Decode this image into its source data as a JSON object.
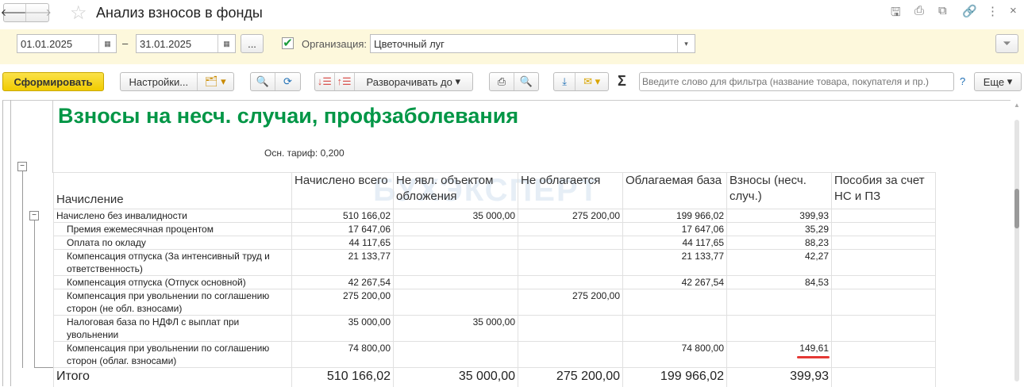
{
  "window": {
    "title": "Анализ взносов в фонды"
  },
  "filters": {
    "date_from": "01.01.2025",
    "date_to": "31.01.2025",
    "dash": "–",
    "more": "...",
    "org_label": "Организация:",
    "org_value": "Цветочный луг",
    "org_checked": true
  },
  "toolbar": {
    "generate": "Сформировать",
    "settings": "Настройки...",
    "expand": "Разворачивать до",
    "filter_placeholder": "Введите слово для фильтра (название товара, покупателя и пр.)",
    "help": "?",
    "more": "Еще",
    "sigma": "Σ"
  },
  "report": {
    "title": "Взносы на несч. случаи, профзаболевания",
    "tariff": "Осн. тариф: 0,200",
    "watermark": "БУХЭКСПЕРТ",
    "columns": [
      "Начисление",
      "Начислено всего",
      "Не явл. объектом обложения",
      "Не облагается",
      "Облагаемая база",
      "Взносы (несч. случ.)",
      "Пособия за счет НС и ПЗ"
    ],
    "rows": [
      {
        "label": "Начислено без инвалидности",
        "v": [
          "510 166,02",
          "35 000,00",
          "275 200,00",
          "199 966,02",
          "399,93",
          ""
        ],
        "group": true
      },
      {
        "label": "Премия ежемесячная процентом",
        "v": [
          "17 647,06",
          "",
          "",
          "17 647,06",
          "35,29",
          ""
        ]
      },
      {
        "label": "Оплата по окладу",
        "v": [
          "44 117,65",
          "",
          "",
          "44 117,65",
          "88,23",
          ""
        ]
      },
      {
        "label": "Компенсация отпуска (За интенсивный труд и ответственность)",
        "v": [
          "21 133,77",
          "",
          "",
          "21 133,77",
          "42,27",
          ""
        ]
      },
      {
        "label": "Компенсация отпуска (Отпуск основной)",
        "v": [
          "42 267,54",
          "",
          "",
          "42 267,54",
          "84,53",
          ""
        ]
      },
      {
        "label": "Компенсация при увольнении по соглашению сторон (не обл. взносами)",
        "v": [
          "275 200,00",
          "",
          "275 200,00",
          "",
          "",
          ""
        ]
      },
      {
        "label": "Налоговая база по НДФЛ с выплат при увольнении",
        "v": [
          "35 000,00",
          "35 000,00",
          "",
          "",
          "",
          ""
        ]
      },
      {
        "label": "Компенсация при увольнении по соглашению сторон (облаг. взносами)",
        "v": [
          "74 800,00",
          "",
          "",
          "74 800,00",
          "149,61",
          ""
        ]
      }
    ],
    "total": {
      "label": "Итого",
      "v": [
        "510 166,02",
        "35 000,00",
        "275 200,00",
        "199 966,02",
        "399,93",
        ""
      ]
    }
  },
  "colors": {
    "title_green": "#009646",
    "accent_yellow": "#f5d507",
    "filter_bar": "#fdf8dc",
    "highlight_red": "#e53935"
  }
}
